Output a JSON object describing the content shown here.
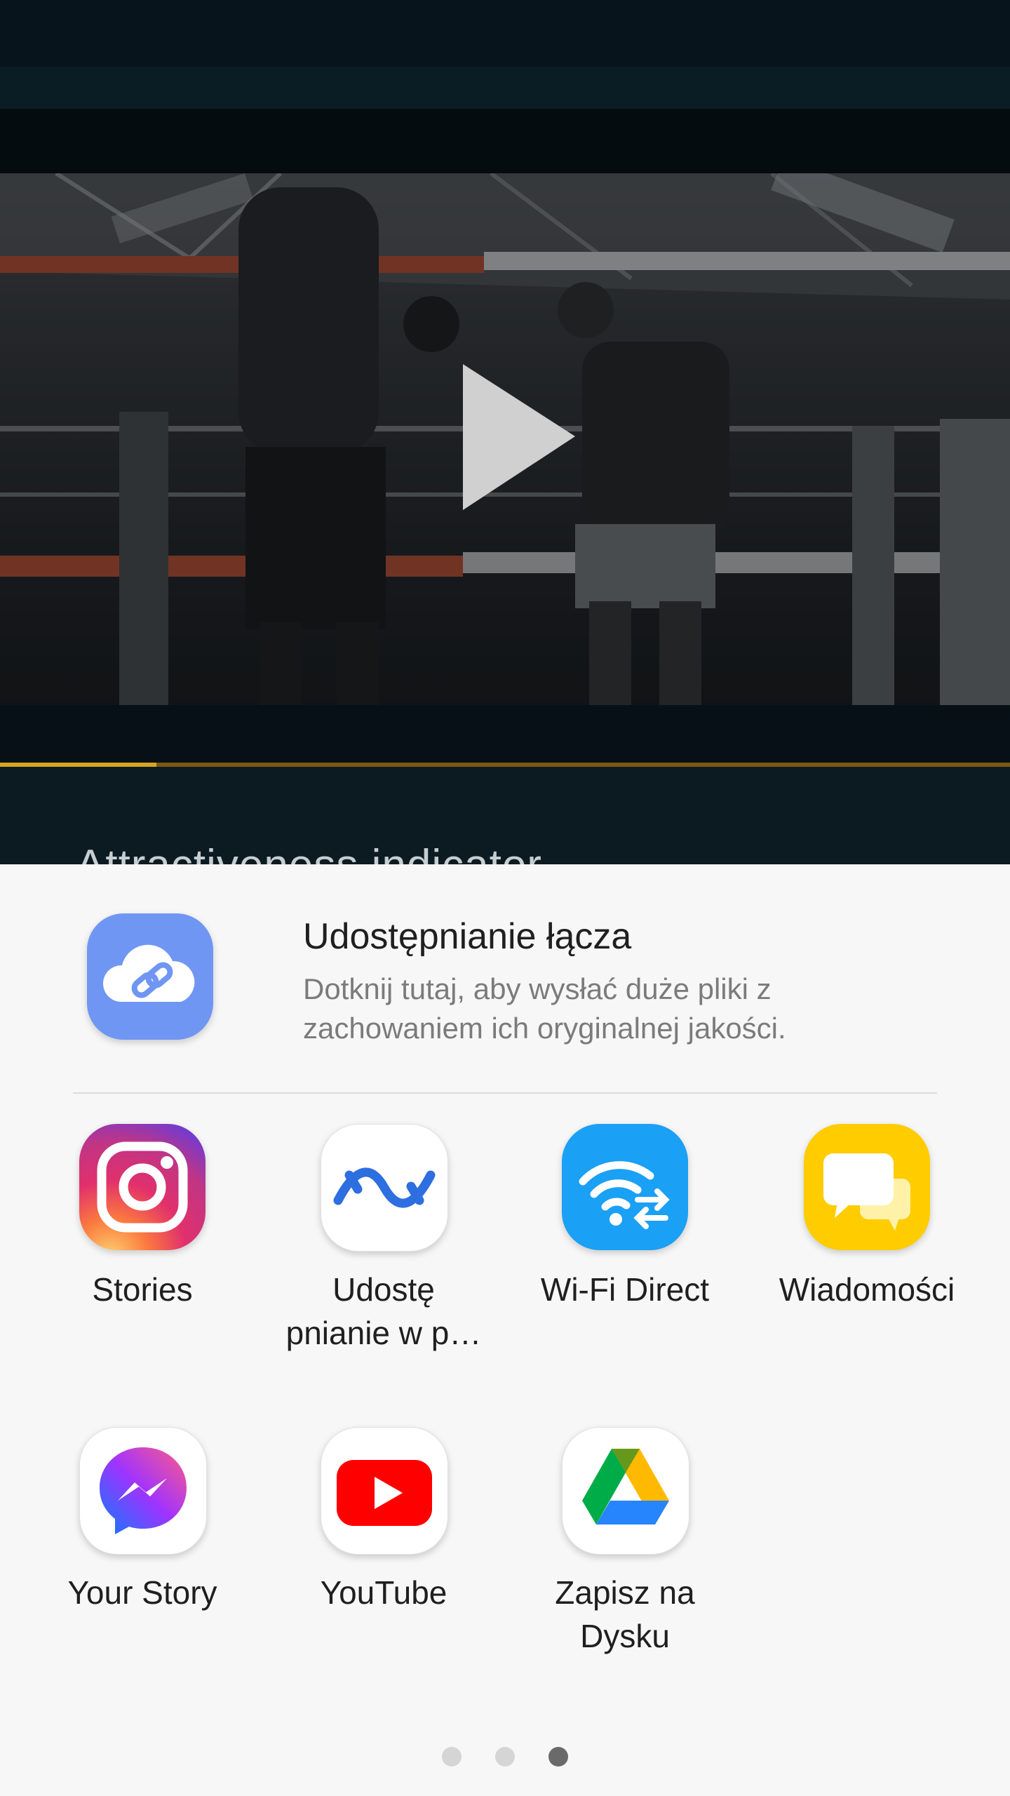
{
  "video": {
    "section_title": "Attractiveness indicator",
    "progress": 0.155
  },
  "share_sheet": {
    "link_sharing": {
      "title": "Udostępnianie łącza",
      "description": "Dotknij tutaj, aby wysłać duże pliki z zachowaniem ich oryginalnej jakości.",
      "icon": "cloud-link-icon"
    },
    "apps": [
      {
        "label": "Stories",
        "icon": "instagram-icon"
      },
      {
        "label": "Udostę pnianie w p…",
        "icon": "nearby-share-icon"
      },
      {
        "label": "Wi-Fi Direct",
        "icon": "wifi-direct-icon"
      },
      {
        "label": "Wiadomości",
        "icon": "messages-icon"
      },
      {
        "label": "Your Story",
        "icon": "messenger-icon"
      },
      {
        "label": "YouTube",
        "icon": "youtube-icon"
      },
      {
        "label": "Zapisz na Dysku",
        "icon": "google-drive-icon"
      }
    ],
    "pagination": {
      "pages": 3,
      "current": 3
    }
  }
}
